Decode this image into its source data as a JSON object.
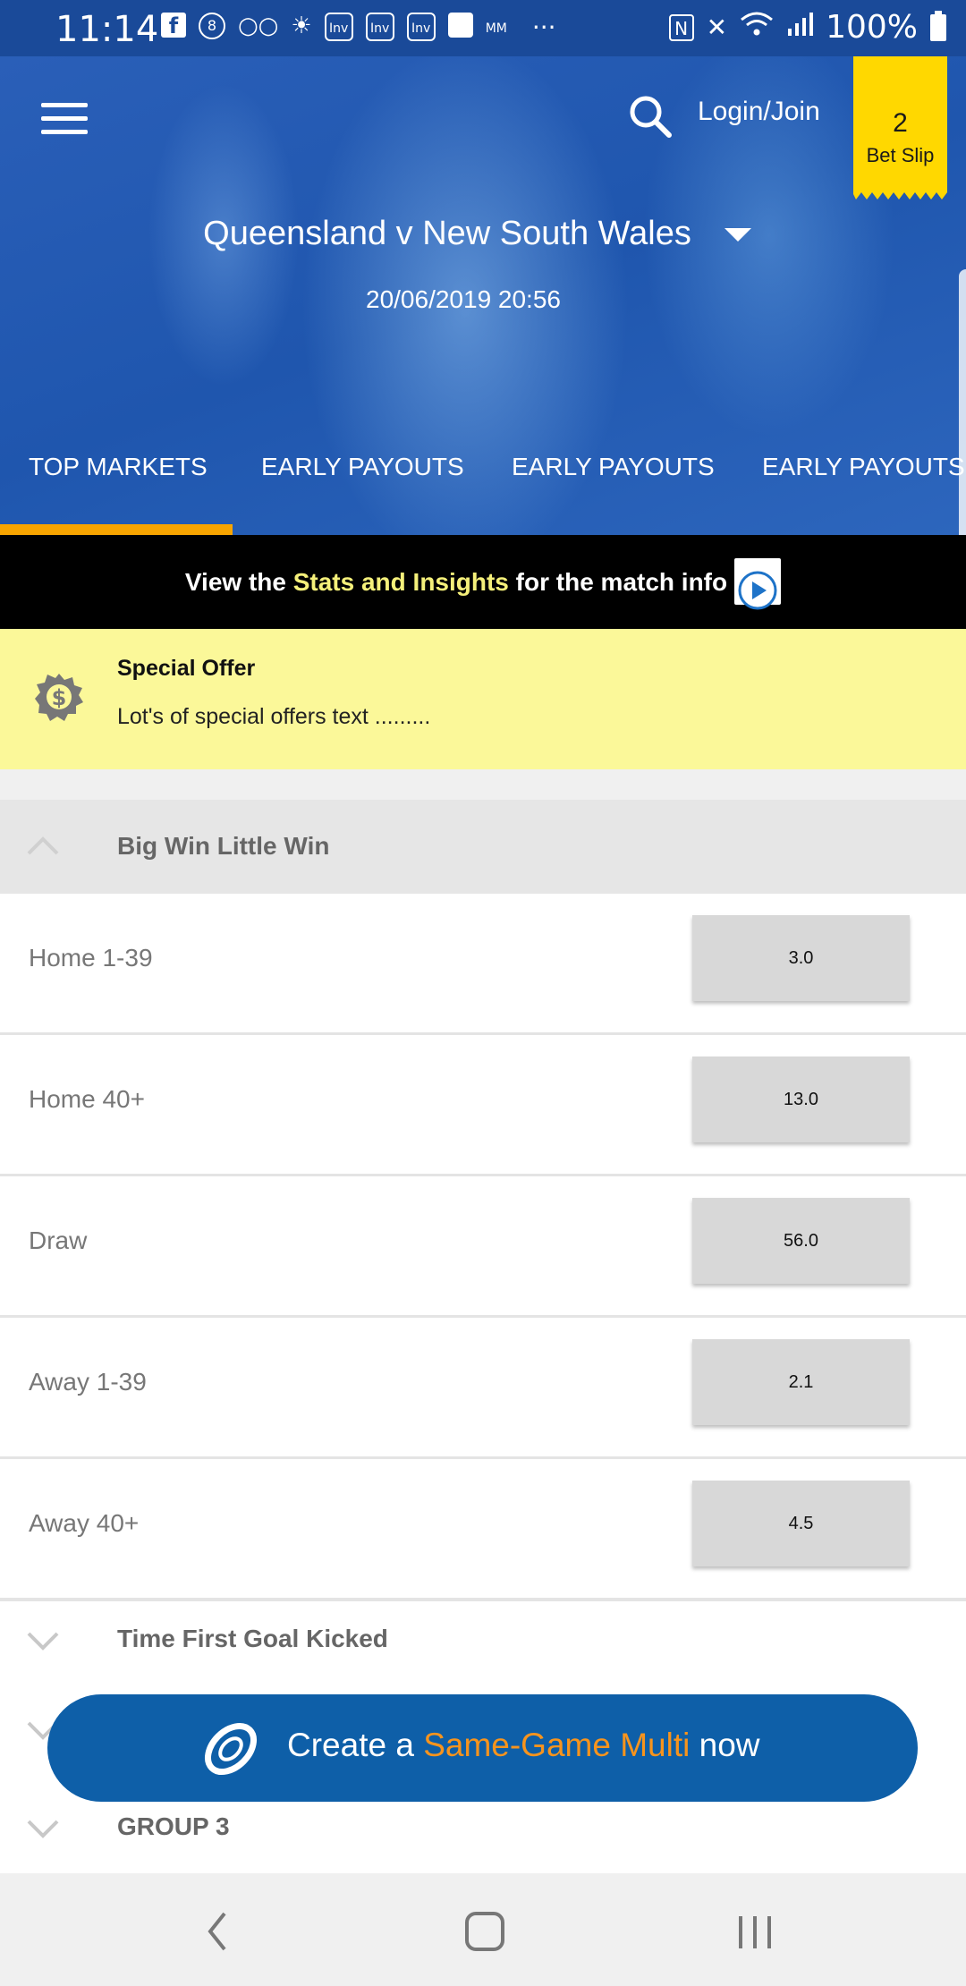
{
  "status_bar": {
    "time": "11:14",
    "battery": "100%",
    "icons": [
      "facebook-icon",
      "notification-8-icon",
      "voicemail-icon",
      "weather-icon",
      "inv-icon",
      "inv-icon",
      "inv-icon",
      "clock-app-icon",
      "mm-icon",
      "more-icon",
      "nfc-icon",
      "mute-icon",
      "wifi-icon",
      "signal-icon",
      "battery-icon"
    ],
    "inv_label": "Inv",
    "mm_label": "MM",
    "dots": "···",
    "nfc_label": "N"
  },
  "header": {
    "login_label": "Login/Join",
    "bet_slip_count": "2",
    "bet_slip_label": "Bet Slip",
    "accent_color": "#ffd800"
  },
  "match": {
    "title": "Queensland v New South Wales",
    "datetime": "20/06/2019 20:56"
  },
  "tabs": [
    {
      "label": "TOP MARKETS",
      "active": true
    },
    {
      "label": "EARLY PAYOUTS",
      "active": false
    },
    {
      "label": "EARLY PAYOUTS",
      "active": false
    },
    {
      "label": "EARLY PAYOUTS",
      "active": false
    }
  ],
  "stats_banner": {
    "prefix": "View the ",
    "highlight": "Stats and Insights",
    "suffix": " for the match info"
  },
  "special_offer": {
    "title": "Special Offer",
    "text": "Lot's of special offers text .........",
    "icon_glyph": "$"
  },
  "market_group": {
    "title": "Big Win Little Win",
    "expanded": true,
    "selections": [
      {
        "label": "Home 1-39",
        "odds": "3.0"
      },
      {
        "label": "Home 40+",
        "odds": "13.0"
      },
      {
        "label": "Draw",
        "odds": "56.0"
      },
      {
        "label": "Away 1-39",
        "odds": "2.1"
      },
      {
        "label": "Away 40+",
        "odds": "4.5"
      }
    ]
  },
  "collapsed_groups": [
    {
      "title": "Time First Goal Kicked"
    },
    {
      "title": "GROUP 3"
    }
  ],
  "same_game_multi": {
    "prefix": "Create a ",
    "highlight": "Same-Game Multi",
    "suffix": " now",
    "color": "#0e5fa8",
    "highlight_color": "#f7941d"
  },
  "colors": {
    "header_blue": "#1f56ae",
    "offer_yellow": "#fbf899",
    "tab_indicator": "#f7a400"
  }
}
